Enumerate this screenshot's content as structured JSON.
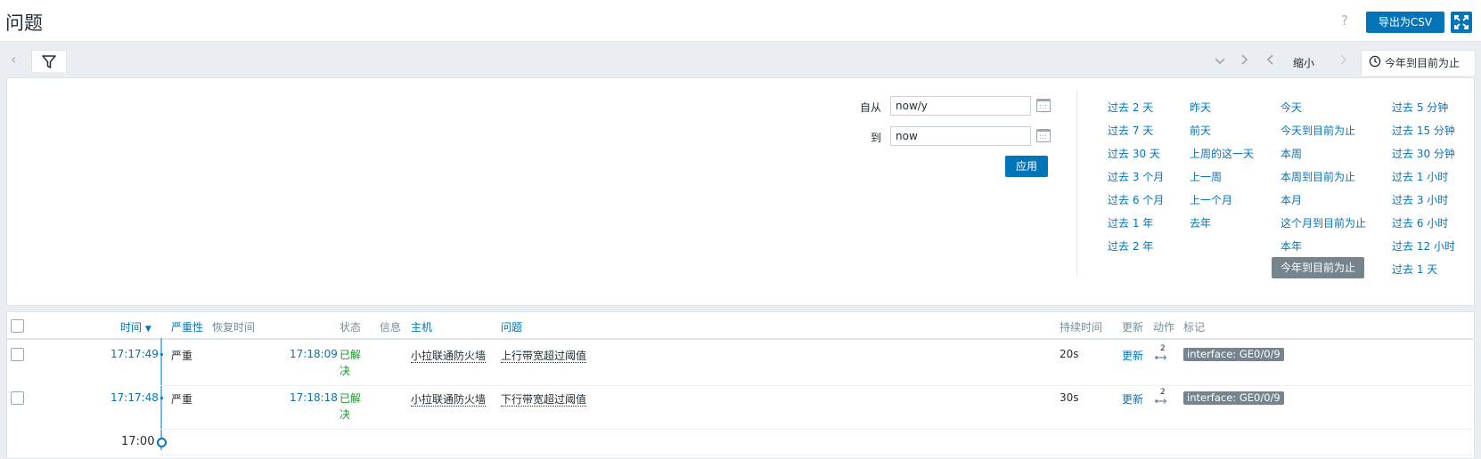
{
  "header": {
    "title": "问题",
    "help": "?",
    "export_label": "导出为CSV"
  },
  "filterbar": {
    "zoom_out_label": "缩小",
    "time_tab_label": "今年到目前为止"
  },
  "filter": {
    "from_label": "自从",
    "from_value": "now/y",
    "to_label": "到",
    "to_value": "now",
    "apply_label": "应用",
    "quick_ranges": [
      [
        "过去 2 天",
        "过去 7 天",
        "过去 30 天",
        "过去 3 个月",
        "过去 6 个月",
        "过去 1 年",
        "过去 2 年"
      ],
      [
        "昨天",
        "前天",
        "上周的这一天",
        "上一周",
        "上一个月",
        "去年"
      ],
      [
        "今天",
        "今天到目前为止",
        "本周",
        "本周到目前为止",
        "本月",
        "这个月到目前为止",
        "本年",
        "今年到目前为止"
      ],
      [
        "过去 5 分钟",
        "过去 15 分钟",
        "过去 30 分钟",
        "过去 1 小时",
        "过去 3 小时",
        "过去 6 小时",
        "过去 12 小时",
        "过去 1 天"
      ]
    ],
    "selected_quick_range": "今年到目前为止"
  },
  "table": {
    "columns": {
      "time": "时间",
      "severity": "严重性",
      "recovery_time": "恢复时间",
      "status": "状态",
      "info": "信息",
      "host": "主机",
      "problem": "问题",
      "duration": "持续时间",
      "update": "更新",
      "actions": "动作",
      "tags": "标记"
    },
    "rows": [
      {
        "time": "17:17:49",
        "severity": "严重",
        "recovery_time": "17:18:09",
        "status": "已解决",
        "host": "小拉联通防火墙",
        "problem": "上行带宽超过阈值",
        "duration": "20s",
        "update": "更新",
        "actions_count": "2",
        "tag": "interface: GE0/0/9"
      },
      {
        "time": "17:17:48",
        "severity": "严重",
        "recovery_time": "17:18:18",
        "status": "已解决",
        "host": "小拉联通防火墙",
        "problem": "下行带宽超过阈值",
        "duration": "30s",
        "update": "更新",
        "actions_count": "2",
        "tag": "interface: GE0/0/9"
      }
    ],
    "timeline_marker": "17:00"
  },
  "colors": {
    "accent": "#0275b8",
    "resolved": "#189a2a",
    "tag_bg": "#76858d"
  }
}
